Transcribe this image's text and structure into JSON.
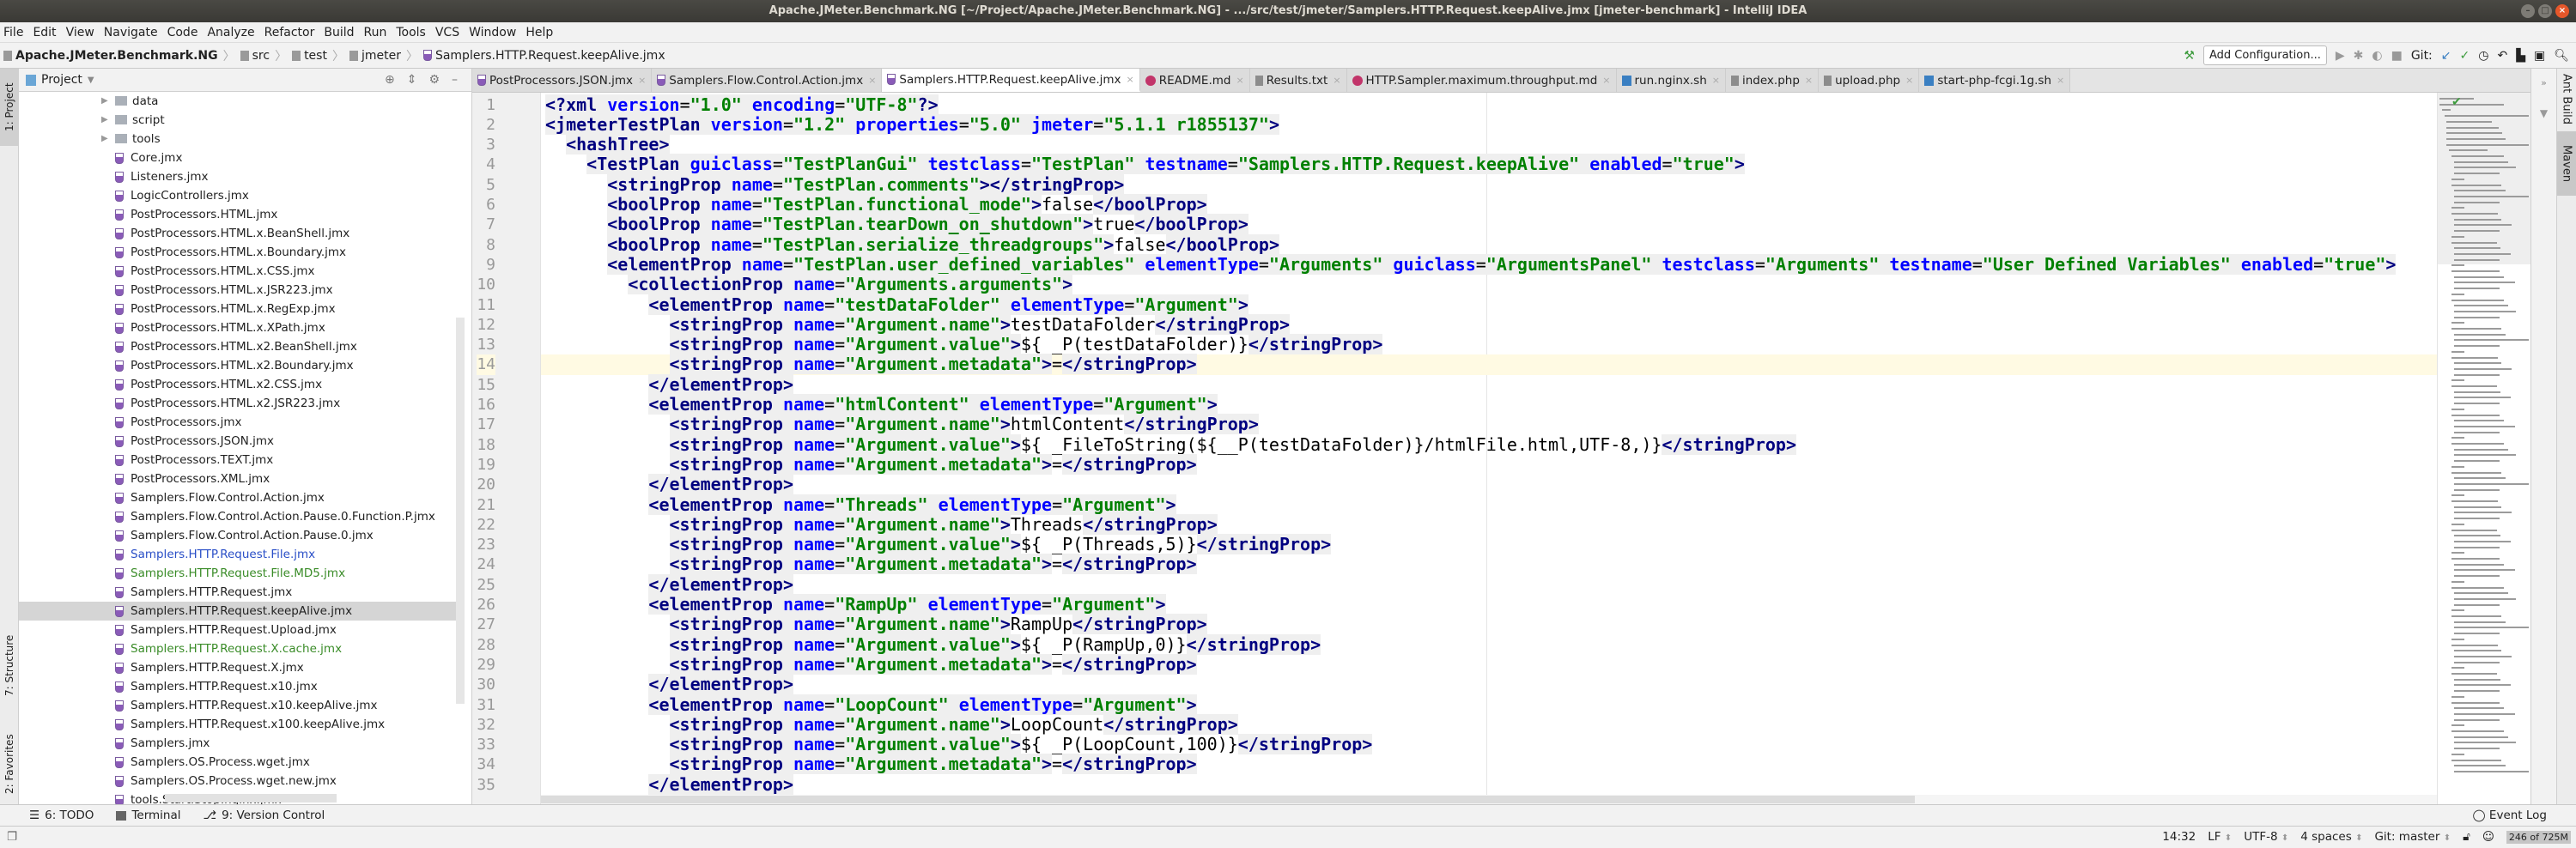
{
  "window": {
    "title": "Apache.JMeter.Benchmark.NG [~/Project/Apache.JMeter.Benchmark.NG] - .../src/test/jmeter/Samplers.HTTP.Request.keepAlive.jmx [jmeter-benchmark] - IntelliJ IDEA"
  },
  "menu": [
    "File",
    "Edit",
    "View",
    "Navigate",
    "Code",
    "Analyze",
    "Refactor",
    "Build",
    "Run",
    "Tools",
    "VCS",
    "Window",
    "Help"
  ],
  "breadcrumb": [
    "Apache.JMeter.Benchmark.NG",
    "src",
    "test",
    "jmeter",
    "Samplers.HTTP.Request.keepAlive.jmx"
  ],
  "toolbar": {
    "add_configuration": "Add Configuration...",
    "git_label": "Git:"
  },
  "left_strip": {
    "project": "1: Project",
    "structure": "7: Structure",
    "favorites": "2: Favorites"
  },
  "right_strip": {
    "ant": "Ant Build",
    "maven": "Maven"
  },
  "project": {
    "title": "Project",
    "items": [
      {
        "label": "data",
        "type": "folder"
      },
      {
        "label": "script",
        "type": "folder"
      },
      {
        "label": "tools",
        "type": "folder"
      },
      {
        "label": "Core.jmx",
        "type": "jmx"
      },
      {
        "label": "Listeners.jmx",
        "type": "jmx"
      },
      {
        "label": "LogicControllers.jmx",
        "type": "jmx"
      },
      {
        "label": "PostProcessors.HTML.jmx",
        "type": "jmx"
      },
      {
        "label": "PostProcessors.HTML.x.BeanShell.jmx",
        "type": "jmx"
      },
      {
        "label": "PostProcessors.HTML.x.Boundary.jmx",
        "type": "jmx"
      },
      {
        "label": "PostProcessors.HTML.x.CSS.jmx",
        "type": "jmx"
      },
      {
        "label": "PostProcessors.HTML.x.JSR223.jmx",
        "type": "jmx"
      },
      {
        "label": "PostProcessors.HTML.x.RegExp.jmx",
        "type": "jmx"
      },
      {
        "label": "PostProcessors.HTML.x.XPath.jmx",
        "type": "jmx"
      },
      {
        "label": "PostProcessors.HTML.x2.BeanShell.jmx",
        "type": "jmx"
      },
      {
        "label": "PostProcessors.HTML.x2.Boundary.jmx",
        "type": "jmx"
      },
      {
        "label": "PostProcessors.HTML.x2.CSS.jmx",
        "type": "jmx"
      },
      {
        "label": "PostProcessors.HTML.x2.JSR223.jmx",
        "type": "jmx"
      },
      {
        "label": "PostProcessors.jmx",
        "type": "jmx"
      },
      {
        "label": "PostProcessors.JSON.jmx",
        "type": "jmx"
      },
      {
        "label": "PostProcessors.TEXT.jmx",
        "type": "jmx"
      },
      {
        "label": "PostProcessors.XML.jmx",
        "type": "jmx"
      },
      {
        "label": "Samplers.Flow.Control.Action.jmx",
        "type": "jmx"
      },
      {
        "label": "Samplers.Flow.Control.Action.Pause.0.Function.P.jmx",
        "type": "jmx"
      },
      {
        "label": "Samplers.Flow.Control.Action.Pause.0.jmx",
        "type": "jmx"
      },
      {
        "label": "Samplers.HTTP.Request.File.jmx",
        "type": "jmx",
        "status": "modified"
      },
      {
        "label": "Samplers.HTTP.Request.File.MD5.jmx",
        "type": "jmx",
        "status": "added"
      },
      {
        "label": "Samplers.HTTP.Request.jmx",
        "type": "jmx"
      },
      {
        "label": "Samplers.HTTP.Request.keepAlive.jmx",
        "type": "jmx",
        "selected": true
      },
      {
        "label": "Samplers.HTTP.Request.Upload.jmx",
        "type": "jmx"
      },
      {
        "label": "Samplers.HTTP.Request.X.cache.jmx",
        "type": "jmx",
        "status": "added"
      },
      {
        "label": "Samplers.HTTP.Request.X.jmx",
        "type": "jmx"
      },
      {
        "label": "Samplers.HTTP.Request.x10.jmx",
        "type": "jmx"
      },
      {
        "label": "Samplers.HTTP.Request.x10.keepAlive.jmx",
        "type": "jmx"
      },
      {
        "label": "Samplers.HTTP.Request.x100.keepAlive.jmx",
        "type": "jmx"
      },
      {
        "label": "Samplers.jmx",
        "type": "jmx"
      },
      {
        "label": "Samplers.OS.Process.wget.jmx",
        "type": "jmx"
      },
      {
        "label": "Samplers.OS.Process.wget.new.jmx",
        "type": "jmx"
      },
      {
        "label": "tools.Start.Stop.nginx.jmx",
        "type": "jmx"
      }
    ]
  },
  "tabs": [
    {
      "label": "PostProcessors.JSON.jmx",
      "icon": "jmx"
    },
    {
      "label": "Samplers.Flow.Control.Action.jmx",
      "icon": "jmx"
    },
    {
      "label": "Samplers.HTTP.Request.keepAlive.jmx",
      "icon": "jmx",
      "active": true
    },
    {
      "label": "README.md",
      "icon": "md"
    },
    {
      "label": "Results.txt",
      "icon": "txt"
    },
    {
      "label": "HTTP.Sampler.maximum.throughput.md",
      "icon": "md"
    },
    {
      "label": "run.nginx.sh",
      "icon": "sh"
    },
    {
      "label": "index.php",
      "icon": "txt"
    },
    {
      "label": "upload.php",
      "icon": "txt"
    },
    {
      "label": "start-php-fcgi.1g.sh",
      "icon": "sh"
    }
  ],
  "editor": {
    "current_line": 14,
    "caret_column": 32,
    "lines": [
      "<?xml version=\"1.0\" encoding=\"UTF-8\"?>",
      "<jmeterTestPlan version=\"1.2\" properties=\"5.0\" jmeter=\"5.1.1 r1855137\">",
      "  <hashTree>",
      "    <TestPlan guiclass=\"TestPlanGui\" testclass=\"TestPlan\" testname=\"Samplers.HTTP.Request.keepAlive\" enabled=\"true\">",
      "      <stringProp name=\"TestPlan.comments\"></stringProp>",
      "      <boolProp name=\"TestPlan.functional_mode\">false</boolProp>",
      "      <boolProp name=\"TestPlan.tearDown_on_shutdown\">true</boolProp>",
      "      <boolProp name=\"TestPlan.serialize_threadgroups\">false</boolProp>",
      "      <elementProp name=\"TestPlan.user_defined_variables\" elementType=\"Arguments\" guiclass=\"ArgumentsPanel\" testclass=\"Arguments\" testname=\"User Defined Variables\" enabled=\"true\">",
      "        <collectionProp name=\"Arguments.arguments\">",
      "          <elementProp name=\"testDataFolder\" elementType=\"Argument\">",
      "            <stringProp name=\"Argument.name\">testDataFolder</stringProp>",
      "            <stringProp name=\"Argument.value\">${__P(testDataFolder)}</stringProp>",
      "            <stringProp name=\"Argument.metadata\">=</stringProp>",
      "          </elementProp>",
      "          <elementProp name=\"htmlContent\" elementType=\"Argument\">",
      "            <stringProp name=\"Argument.name\">htmlContent</stringProp>",
      "            <stringProp name=\"Argument.value\">${__FileToString(${__P(testDataFolder)}/htmlFile.html,UTF-8,)}</stringProp>",
      "            <stringProp name=\"Argument.metadata\">=</stringProp>",
      "          </elementProp>",
      "          <elementProp name=\"Threads\" elementType=\"Argument\">",
      "            <stringProp name=\"Argument.name\">Threads</stringProp>",
      "            <stringProp name=\"Argument.value\">${__P(Threads,5)}</stringProp>",
      "            <stringProp name=\"Argument.metadata\">=</stringProp>",
      "          </elementProp>",
      "          <elementProp name=\"RampUp\" elementType=\"Argument\">",
      "            <stringProp name=\"Argument.name\">RampUp</stringProp>",
      "            <stringProp name=\"Argument.value\">${__P(RampUp,0)}</stringProp>",
      "            <stringProp name=\"Argument.metadata\">=</stringProp>",
      "          </elementProp>",
      "          <elementProp name=\"LoopCount\" elementType=\"Argument\">",
      "            <stringProp name=\"Argument.name\">LoopCount</stringProp>",
      "            <stringProp name=\"Argument.value\">${__P(LoopCount,100)}</stringProp>",
      "            <stringProp name=\"Argument.metadata\">=</stringProp>",
      "          </elementProp>"
    ]
  },
  "bottom_tools": {
    "todo": "6: TODO",
    "terminal": "Terminal",
    "vcs": "9: Version Control",
    "event_log": "Event Log"
  },
  "status": {
    "position": "14:32",
    "line_sep": "LF",
    "encoding": "UTF-8",
    "indent": "4 spaces",
    "git": "Git: master",
    "memory": "246 of 725M"
  },
  "colors": {
    "tag": "#000080",
    "attr": "#0000ff",
    "value": "#008000",
    "modified": "#2a4fc7",
    "added": "#3a8c28",
    "current_line": "#fffae3"
  }
}
